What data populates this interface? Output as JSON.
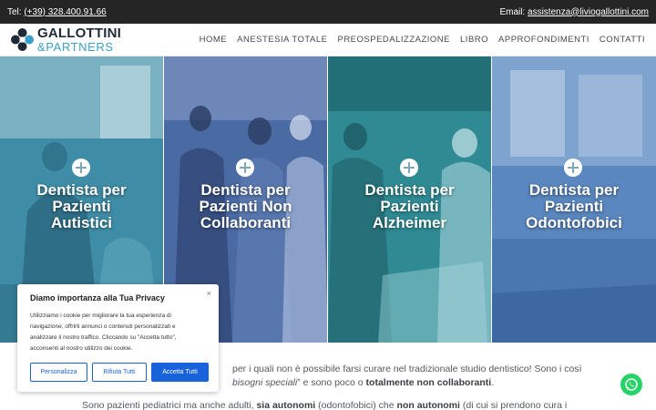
{
  "topbar": {
    "phone_prefix": "Tel: ",
    "phone": "(+39) 328.400.91.66",
    "email_prefix": "Email: ",
    "email": "assistenza@liviogallottini.com"
  },
  "header": {
    "logo_name": "GALLOTTINI",
    "logo_sub": "&PARTNERS",
    "nav": [
      "HOME",
      "ANESTESIA TOTALE",
      "PREOSPEDALIZZAZIONE",
      "LIBRO",
      "APPROFONDIMENTI",
      "CONTATTI"
    ]
  },
  "hero": {
    "panels": [
      {
        "lines": [
          "Dentista per",
          "Pazienti",
          "Autistici"
        ],
        "tint": "#3f8ca6"
      },
      {
        "lines": [
          "Dentista per",
          "Pazienti Non",
          "Collaboranti"
        ],
        "tint": "#4a6aa3"
      },
      {
        "lines": [
          "Dentista per",
          "Pazienti",
          "Alzheimer"
        ],
        "tint": "#2f8a94"
      },
      {
        "lines": [
          "Dentista per",
          "Pazienti",
          "Odontofobici"
        ],
        "tint": "#5a87bf"
      }
    ]
  },
  "content": {
    "line1_a": "per i quali non è possibile farsi curare nel tradizionale studio dentistico! Sono i così",
    "line2_a": "bisogni speciali",
    "line2_b": "” e sono poco o ",
    "line2_c": "totalmente non collaboranti",
    "line2_d": ".",
    "line3_a": "Sono pazienti pediatrici ma anche adulti, ",
    "line3_b": "sia autonomi",
    "line3_c": " (odontofobici) che ",
    "line3_d": "non autonomi",
    "line3_e": " (di cui si prendono cura i"
  },
  "cookie": {
    "title": "Diamo importanza alla Tua Privacy",
    "text_lines": [
      "Utilizziamo i cookie per migliorare la tua esperienza di",
      "navigazione, offrirti annunci o contenuti personalizzati e",
      "analizzare il nostro traffico. Cliccando su \"Accetta tutto\",",
      "acconsenti al nostro utilizzo dei cookie."
    ],
    "close": "×",
    "buttons": [
      "Personalizza",
      "Rifiuta Tutti",
      "Accetta Tutti"
    ]
  },
  "colors": {
    "topbar_bg": "#252525",
    "accent": "#3aa0c8",
    "cookie_button": "#1863dc",
    "whatsapp": "#25d366"
  }
}
